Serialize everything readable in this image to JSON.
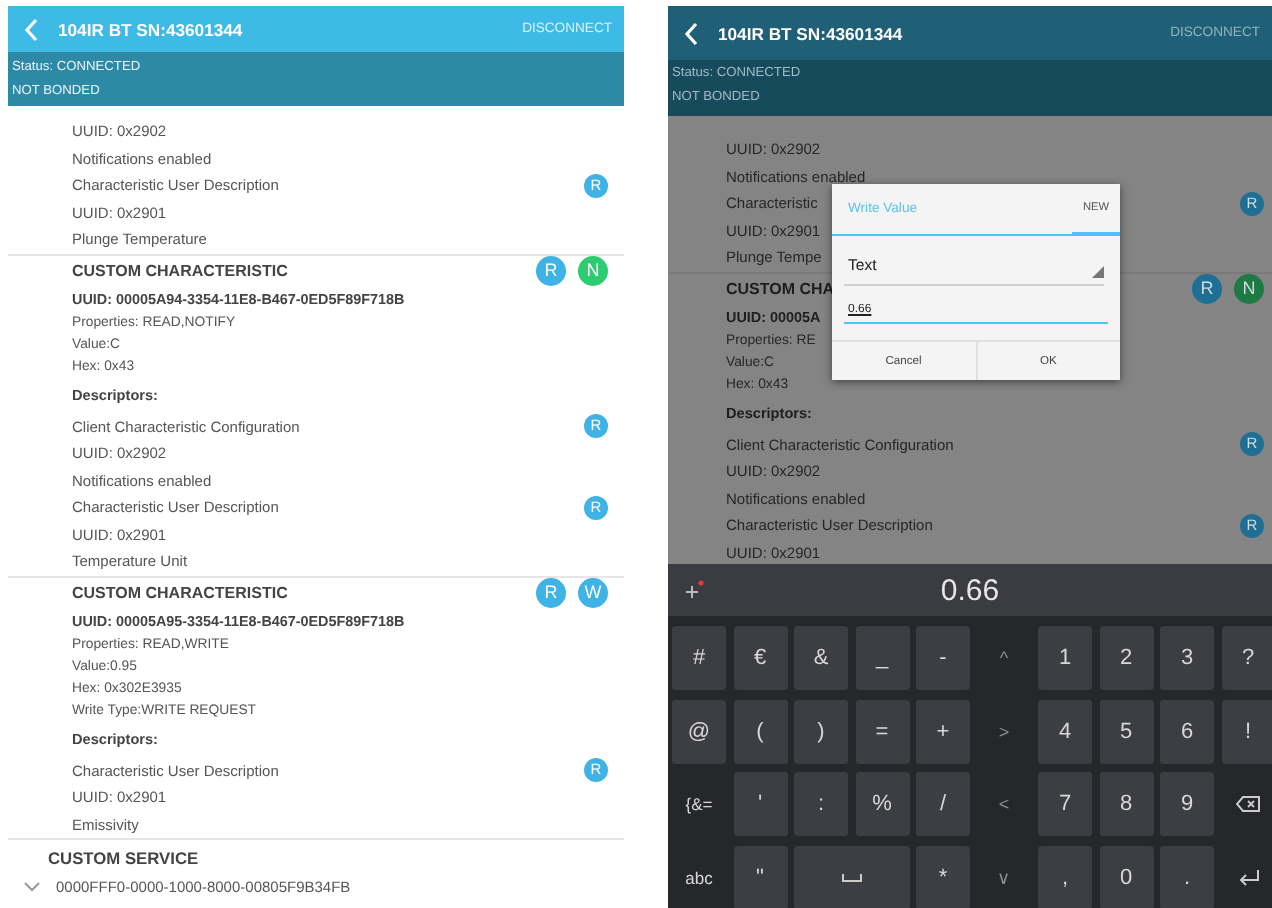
{
  "screens": [
    {
      "dimmed": false,
      "header": {
        "title": "104IR BT SN:43601344",
        "action": "DISCONNECT"
      },
      "status_lines": [
        "Status: CONNECTED",
        "NOT BONDED"
      ],
      "rows": [
        {
          "kind": "descriptor",
          "text": "UUID: 0x2902"
        },
        {
          "kind": "descriptor",
          "text": "Notifications enabled"
        },
        {
          "kind": "descriptor",
          "text": "Characteristic User Description",
          "badges": [
            {
              "letter": "R",
              "color": "#3fb2e6"
            }
          ]
        },
        {
          "kind": "descriptor",
          "text": "UUID: 0x2901"
        },
        {
          "kind": "descriptor",
          "text": "Plunge Temperature"
        },
        {
          "kind": "characteristic",
          "text": "CUSTOM CHARACTERISTIC",
          "badges": [
            {
              "letter": "R",
              "color": "#3fb2e6"
            },
            {
              "letter": "N",
              "color": "#2ecc71"
            }
          ]
        },
        {
          "kind": "uuid",
          "text": "UUID: 00005A94-3354-11E8-B467-0ED5F89F718B"
        },
        {
          "kind": "property",
          "text": "Properties: READ,NOTIFY"
        },
        {
          "kind": "property",
          "text": "Value:C"
        },
        {
          "kind": "property",
          "text": "Hex: 0x43"
        },
        {
          "kind": "heading",
          "text": "Descriptors:"
        },
        {
          "kind": "descriptor",
          "text": "Client Characteristic Configuration",
          "badges": [
            {
              "letter": "R",
              "color": "#3fb2e6"
            }
          ]
        },
        {
          "kind": "descriptor",
          "text": "UUID: 0x2902"
        },
        {
          "kind": "descriptor",
          "text": "Notifications enabled"
        },
        {
          "kind": "descriptor",
          "text": "Characteristic User Description",
          "badges": [
            {
              "letter": "R",
              "color": "#3fb2e6"
            }
          ]
        },
        {
          "kind": "descriptor",
          "text": "UUID: 0x2901"
        },
        {
          "kind": "descriptor",
          "text": "Temperature Unit"
        },
        {
          "kind": "characteristic",
          "text": "CUSTOM CHARACTERISTIC",
          "badges": [
            {
              "letter": "R",
              "color": "#3fb2e6"
            },
            {
              "letter": "W",
              "color": "#3fb2e6"
            }
          ]
        },
        {
          "kind": "uuid",
          "text": "UUID: 00005A95-3354-11E8-B467-0ED5F89F718B"
        },
        {
          "kind": "property",
          "text": "Properties: READ,WRITE"
        },
        {
          "kind": "property",
          "text": "Value:0.95"
        },
        {
          "kind": "property",
          "text": "Hex: 0x302E3935"
        },
        {
          "kind": "property",
          "text": "Write Type:WRITE REQUEST"
        },
        {
          "kind": "heading",
          "text": "Descriptors:"
        },
        {
          "kind": "descriptor",
          "text": "Characteristic User Description",
          "badges": [
            {
              "letter": "R",
              "color": "#3fb2e6"
            }
          ]
        },
        {
          "kind": "descriptor",
          "text": "UUID: 0x2901"
        },
        {
          "kind": "descriptor",
          "text": "Emissivity"
        },
        {
          "kind": "service",
          "text": "CUSTOM SERVICE"
        },
        {
          "kind": "service_uuid",
          "text": "0000FFF0-0000-1000-8000-00805F9B34FB"
        }
      ]
    },
    {
      "dimmed": true,
      "header": {
        "title": "104IR BT SN:43601344",
        "action": "DISCONNECT"
      },
      "status_lines": [
        "Status: CONNECTED",
        "NOT BONDED"
      ],
      "rows": [
        {
          "kind": "descriptor",
          "text": "UUID: 0x2902"
        },
        {
          "kind": "descriptor",
          "text": "Notifications enabled"
        },
        {
          "kind": "descriptor",
          "text": "Characteristic",
          "badges": [
            {
              "letter": "R",
              "color": "#1f6f94"
            }
          ]
        },
        {
          "kind": "descriptor",
          "text": "UUID: 0x2901"
        },
        {
          "kind": "descriptor",
          "text": "Plunge Tempe"
        },
        {
          "kind": "characteristic",
          "text": "CUSTOM CHA",
          "badges": [
            {
              "letter": "R",
              "color": "#1f6f94"
            },
            {
              "letter": "N",
              "color": "#1d7a45"
            }
          ]
        },
        {
          "kind": "uuid",
          "text": "UUID: 00005A"
        },
        {
          "kind": "property",
          "text": "Properties: RE"
        },
        {
          "kind": "property",
          "text": "Value:C"
        },
        {
          "kind": "property",
          "text": "Hex: 0x43"
        },
        {
          "kind": "heading",
          "text": "Descriptors:"
        },
        {
          "kind": "descriptor",
          "text": "Client Characteristic Configuration",
          "badges": [
            {
              "letter": "R",
              "color": "#1f6f94"
            }
          ]
        },
        {
          "kind": "descriptor",
          "text": "UUID: 0x2902"
        },
        {
          "kind": "descriptor",
          "text": "Notifications enabled"
        },
        {
          "kind": "descriptor",
          "text": "Characteristic User Description",
          "badges": [
            {
              "letter": "R",
              "color": "#1f6f94"
            }
          ]
        },
        {
          "kind": "descriptor",
          "text": "UUID: 0x2901"
        }
      ],
      "dialog": {
        "title": "Write Value",
        "tab": {
          "label": "NEW",
          "selected": true
        },
        "type_field": "Text",
        "value": "0.66",
        "buttons": [
          "Cancel",
          "OK"
        ]
      },
      "keyboard": {
        "suggestion": "0.66",
        "rows": [
          {
            "keys": [
              {
                "kind": "key",
                "label": "#"
              },
              {
                "kind": "key",
                "label": "€"
              },
              {
                "kind": "key",
                "label": "&"
              },
              {
                "kind": "key",
                "label": "_"
              },
              {
                "kind": "key",
                "label": "-"
              },
              {
                "kind": "arrow",
                "label": "^"
              },
              {
                "kind": "key",
                "label": "1"
              },
              {
                "kind": "key",
                "label": "2"
              },
              {
                "kind": "key",
                "label": "3"
              },
              {
                "kind": "key",
                "label": "?"
              }
            ]
          },
          {
            "keys": [
              {
                "kind": "key",
                "label": "@"
              },
              {
                "kind": "key",
                "label": "("
              },
              {
                "kind": "key",
                "label": ")"
              },
              {
                "kind": "key",
                "label": "="
              },
              {
                "kind": "key",
                "label": "+"
              },
              {
                "kind": "arrow",
                "label": ">"
              },
              {
                "kind": "key",
                "label": "4"
              },
              {
                "kind": "key",
                "label": "5"
              },
              {
                "kind": "key",
                "label": "6"
              },
              {
                "kind": "key",
                "label": "!"
              }
            ]
          },
          {
            "keys": [
              {
                "kind": "mode",
                "label": "{&="
              },
              {
                "kind": "key",
                "label": "'"
              },
              {
                "kind": "key",
                "label": ":"
              },
              {
                "kind": "key",
                "label": "%"
              },
              {
                "kind": "key",
                "label": "/"
              },
              {
                "kind": "arrow",
                "label": "<"
              },
              {
                "kind": "key",
                "label": "7"
              },
              {
                "kind": "key",
                "label": "8"
              },
              {
                "kind": "key",
                "label": "9"
              },
              {
                "kind": "backspace"
              }
            ]
          },
          {
            "keys": [
              {
                "kind": "mode",
                "label": "abc"
              },
              {
                "kind": "key",
                "label": "\""
              },
              {
                "kind": "space"
              },
              {
                "kind": "key",
                "label": "*"
              },
              {
                "kind": "arrow",
                "label": "∨"
              },
              {
                "kind": "key",
                "label": ","
              },
              {
                "kind": "key",
                "label": "0"
              },
              {
                "kind": "key",
                "label": "."
              },
              {
                "kind": "enter"
              }
            ]
          }
        ]
      }
    }
  ]
}
